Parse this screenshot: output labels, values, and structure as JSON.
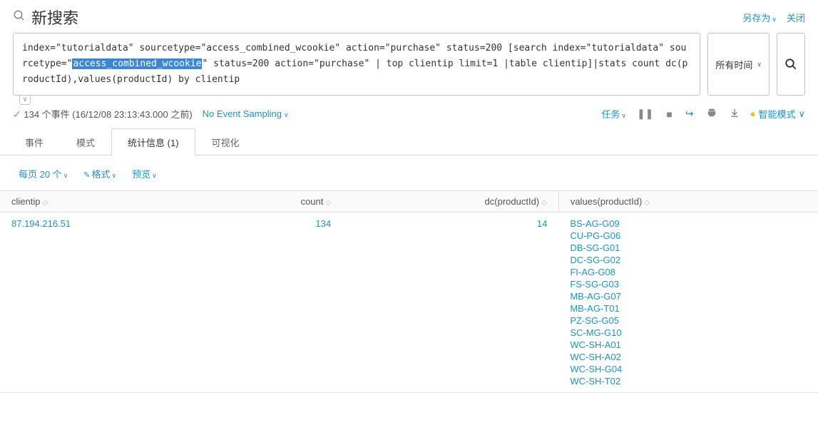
{
  "header": {
    "title": "新搜索",
    "save_as": "另存为",
    "close": "关闭"
  },
  "search": {
    "query_pre": "index=\"tutorialdata\" sourcetype=\"access_combined_wcookie\" action=\"purchase\" status=200 [search index=\"tutorialdata\"  sourcetype=\"",
    "query_highlight": "access_combined_wcookie",
    "query_post": "\" status=200 action=\"purchase\" | top clientip limit=1 |table clientip]|stats count dc(productId),values(productId) by clientip",
    "time_range": "所有时间"
  },
  "status": {
    "events_text": "134 个事件 (16/12/08 23:13:43.000 之前)",
    "sampling": "No Event Sampling",
    "tasks": "任务",
    "smart_mode": "智能模式"
  },
  "tabs": {
    "events": "事件",
    "patterns": "模式",
    "statistics": "统计信息 (1)",
    "visualization": "可视化"
  },
  "toolbar": {
    "per_page": "每页 20 个",
    "format": "格式",
    "preview": "预览"
  },
  "columns": {
    "clientip": "clientip",
    "count": "count",
    "dc": "dc(productId)",
    "values": "values(productId)"
  },
  "row": {
    "clientip": "87.194.216.51",
    "count": "134",
    "dc": "14",
    "values": [
      "BS-AG-G09",
      "CU-PG-G06",
      "DB-SG-G01",
      "DC-SG-G02",
      "FI-AG-G08",
      "FS-SG-G03",
      "MB-AG-G07",
      "MB-AG-T01",
      "PZ-SG-G05",
      "SC-MG-G10",
      "WC-SH-A01",
      "WC-SH-A02",
      "WC-SH-G04",
      "WC-SH-T02"
    ]
  }
}
